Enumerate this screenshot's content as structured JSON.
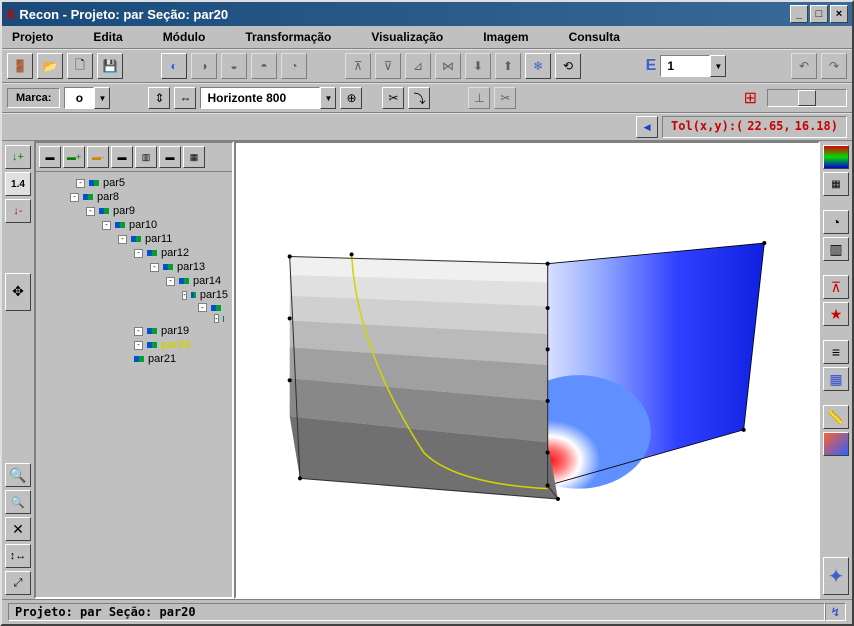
{
  "titlebar": {
    "text": "Recon - Projeto: par  Seção: par20"
  },
  "menu": {
    "projeto": "Projeto",
    "edita": "Edita",
    "modulo": "Módulo",
    "transformacao": "Transformação",
    "visualizacao": "Visualização",
    "imagem": "Imagem",
    "consulta": "Consulta"
  },
  "toolbar1": {
    "spinner_value": "1"
  },
  "toolbar2": {
    "marca_label": "Marca:",
    "marca_value": "o",
    "horizonte": "Horizonte 800"
  },
  "coords": {
    "label": "Tol(x,y):(",
    "x": "22.65,",
    "y": "16.18)"
  },
  "left_label": "1.4",
  "tree": {
    "nodes": [
      {
        "indent": 36,
        "label": "par5",
        "toggle": "-"
      },
      {
        "indent": 30,
        "label": "par8",
        "toggle": "-"
      },
      {
        "indent": 46,
        "label": "par9",
        "toggle": "-"
      },
      {
        "indent": 62,
        "label": "par10",
        "toggle": "-"
      },
      {
        "indent": 78,
        "label": "par11",
        "toggle": "-"
      },
      {
        "indent": 94,
        "label": "par12",
        "toggle": "-"
      },
      {
        "indent": 110,
        "label": "par13",
        "toggle": "-"
      },
      {
        "indent": 126,
        "label": "par14",
        "toggle": "-"
      },
      {
        "indent": 142,
        "label": "par15",
        "toggle": "-"
      },
      {
        "indent": 158,
        "label": "",
        "toggle": "-"
      },
      {
        "indent": 174,
        "label": "",
        "toggle": "-"
      },
      {
        "indent": 94,
        "label": "par19",
        "toggle": "-"
      },
      {
        "indent": 94,
        "label": "par20",
        "toggle": "-",
        "selected": true
      },
      {
        "indent": 94,
        "label": "par21",
        "toggle": ""
      }
    ]
  },
  "statusbar": {
    "text": "Projeto: par  Seção: par20"
  }
}
